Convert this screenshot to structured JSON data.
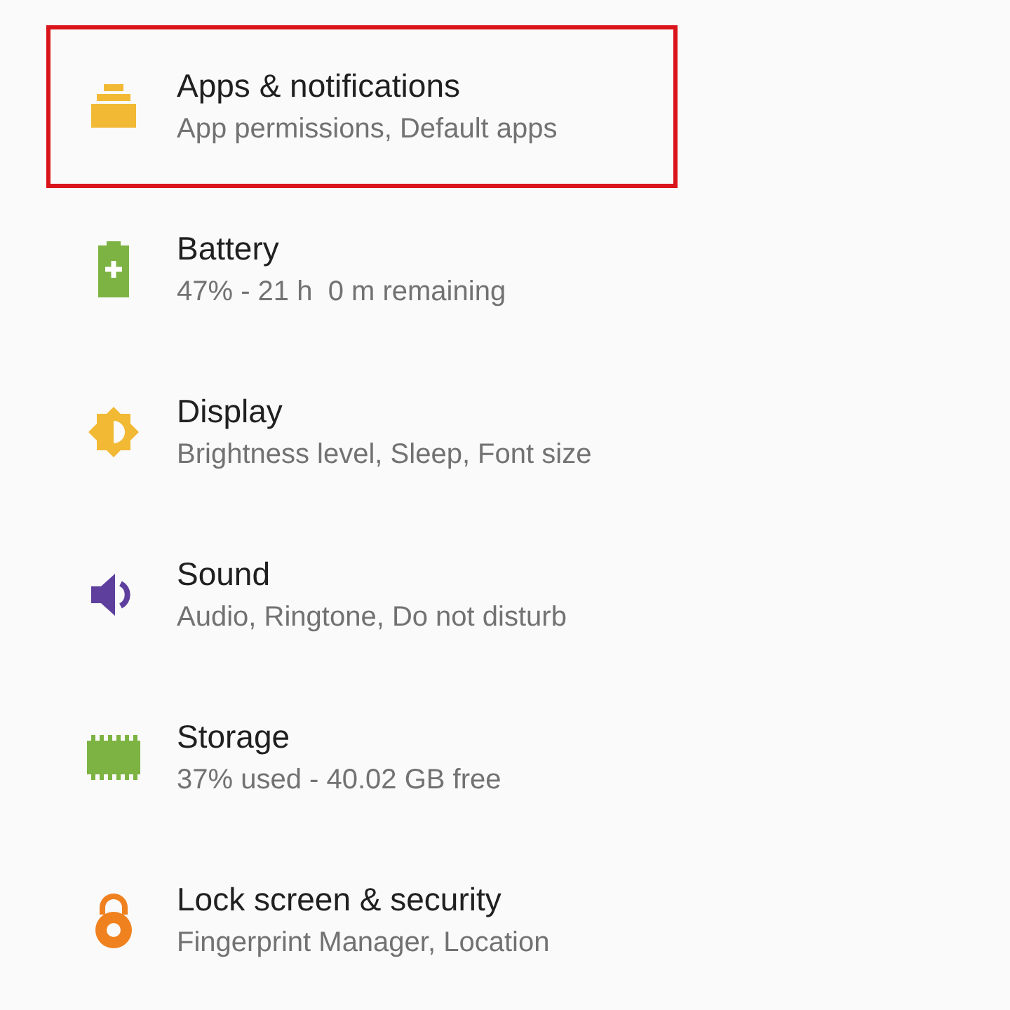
{
  "settings": [
    {
      "kind": "apps",
      "title": "Apps & notifications",
      "summary": "App permissions, Default apps",
      "highlighted": true
    },
    {
      "kind": "battery",
      "title": "Battery",
      "summary": "47% - 21 h  0 m remaining",
      "highlighted": false
    },
    {
      "kind": "display",
      "title": "Display",
      "summary": "Brightness level, Sleep, Font size",
      "highlighted": false
    },
    {
      "kind": "sound",
      "title": "Sound",
      "summary": "Audio, Ringtone, Do not disturb",
      "highlighted": false
    },
    {
      "kind": "storage",
      "title": "Storage",
      "summary": "37% used - 40.02 GB free",
      "highlighted": false
    },
    {
      "kind": "lock",
      "title": "Lock screen & security",
      "summary": "Fingerprint Manager, Location",
      "highlighted": false
    }
  ]
}
